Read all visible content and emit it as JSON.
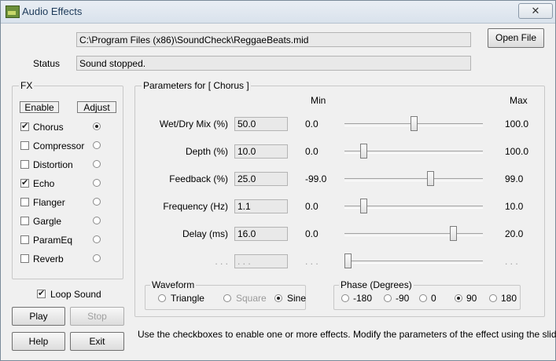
{
  "window": {
    "title": "Audio Effects",
    "close_glyph": "✕"
  },
  "file": {
    "path": "C:\\Program Files (x86)\\SoundCheck\\ReggaeBeats.mid",
    "open_label": "Open File"
  },
  "status": {
    "label": "Status",
    "value": "Sound stopped."
  },
  "fx": {
    "title": "FX",
    "enable_header": "Enable",
    "adjust_header": "Adjust",
    "items": [
      {
        "label": "Chorus",
        "enabled": true,
        "adjust": true
      },
      {
        "label": "Compressor",
        "enabled": false,
        "adjust": false
      },
      {
        "label": "Distortion",
        "enabled": false,
        "adjust": false
      },
      {
        "label": "Echo",
        "enabled": true,
        "adjust": false
      },
      {
        "label": "Flanger",
        "enabled": false,
        "adjust": false
      },
      {
        "label": "Gargle",
        "enabled": false,
        "adjust": false
      },
      {
        "label": "ParamEq",
        "enabled": false,
        "adjust": false
      },
      {
        "label": "Reverb",
        "enabled": false,
        "adjust": false
      }
    ]
  },
  "loop": {
    "label": "Loop Sound",
    "checked": true
  },
  "buttons": {
    "play": "Play",
    "stop": "Stop",
    "help": "Help",
    "exit": "Exit"
  },
  "params": {
    "title": "Parameters for [ Chorus ]",
    "min_header": "Min",
    "max_header": "Max",
    "rows": [
      {
        "label": "Wet/Dry Mix (%)",
        "value": "50.0",
        "min": "0.0",
        "max": "100.0",
        "fraction": 0.5
      },
      {
        "label": "Depth (%)",
        "value": "10.0",
        "min": "0.0",
        "max": "100.0",
        "fraction": 0.12
      },
      {
        "label": "Feedback (%)",
        "value": "25.0",
        "min": "-99.0",
        "max": "99.0",
        "fraction": 0.63
      },
      {
        "label": "Frequency (Hz)",
        "value": "1.1",
        "min": "0.0",
        "max": "10.0",
        "fraction": 0.12
      },
      {
        "label": "Delay (ms)",
        "value": "16.0",
        "min": "0.0",
        "max": "20.0",
        "fraction": 0.8
      },
      {
        "label": ". . .",
        "value": ". . .",
        "min": ". . .",
        "max": ". . .",
        "fraction": 0.0,
        "disabled": true
      }
    ]
  },
  "waveform": {
    "title": "Waveform",
    "options": [
      {
        "label": "Triangle",
        "checked": false,
        "disabled": false
      },
      {
        "label": "Square",
        "checked": false,
        "disabled": true
      },
      {
        "label": "Sine",
        "checked": true,
        "disabled": false
      }
    ]
  },
  "phase": {
    "title": "Phase (Degrees)",
    "options": [
      {
        "label": "-180",
        "checked": false
      },
      {
        "label": "-90",
        "checked": false
      },
      {
        "label": "0",
        "checked": false
      },
      {
        "label": "90",
        "checked": true
      },
      {
        "label": "180",
        "checked": false
      }
    ]
  },
  "help_text": "Use the checkboxes to enable one or more effects. Modify the parameters of the effect using the slidebars."
}
